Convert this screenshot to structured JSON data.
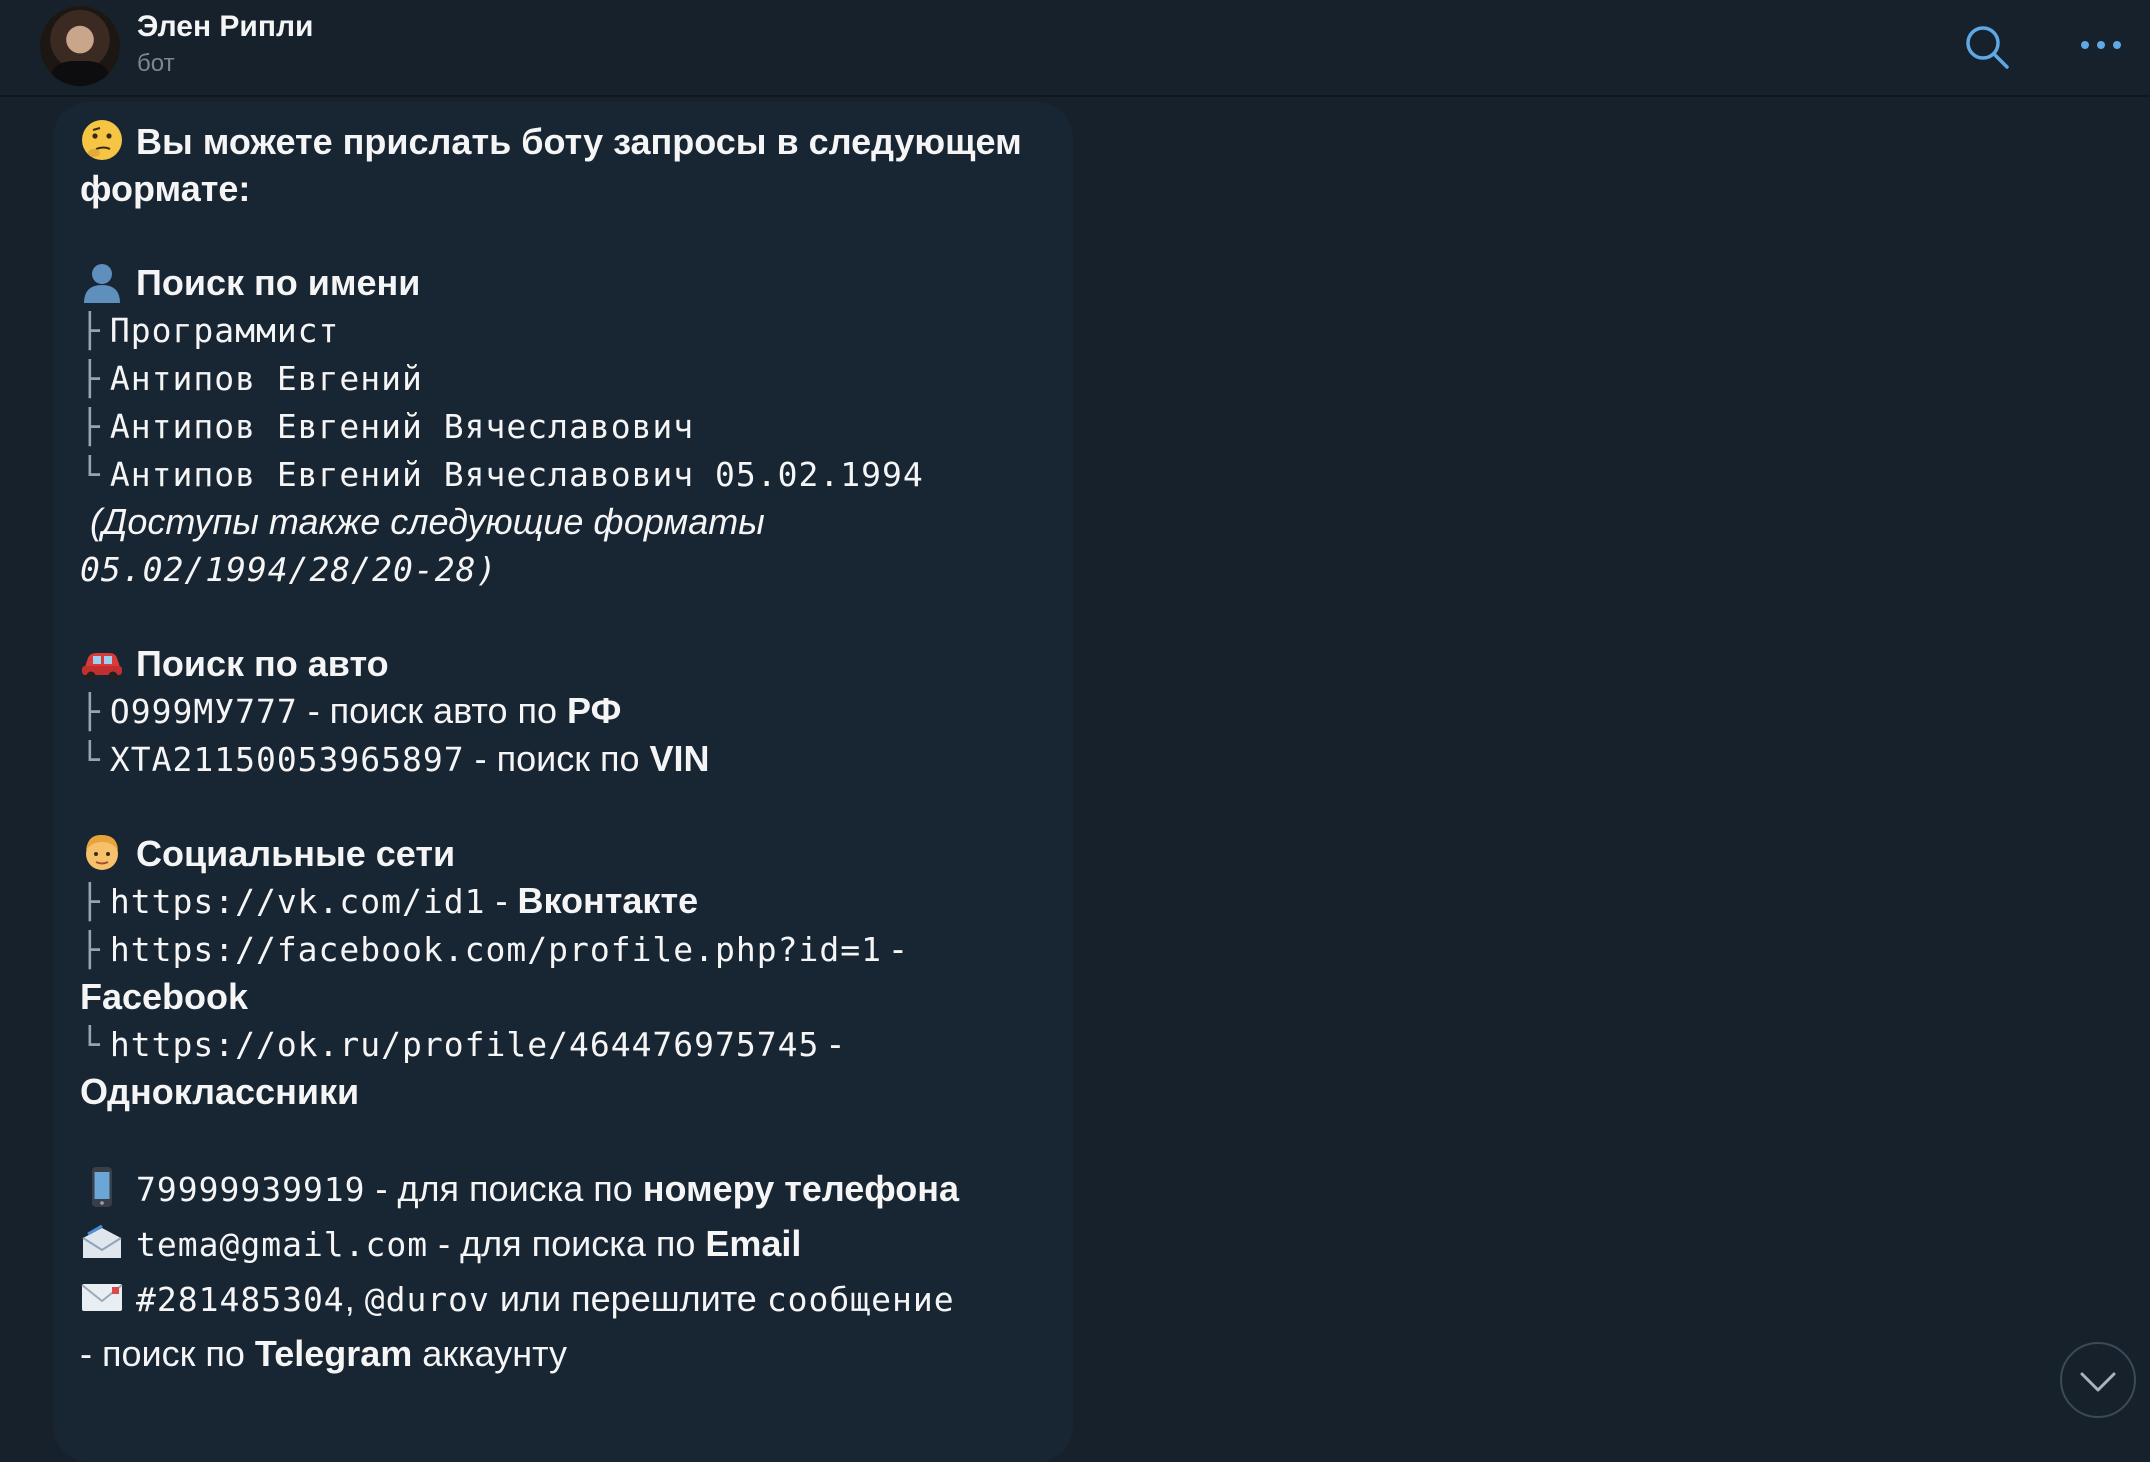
{
  "header": {
    "title": "Элен Рипли",
    "subtitle": "бот"
  },
  "icons": {
    "search": "search-icon",
    "more": "more-icon",
    "scroll_down": "chevron-down-icon"
  },
  "message": {
    "intro": "Вы можете прислать боту запросы в следующем",
    "intro2": "формате:",
    "name_search": {
      "heading": "Поиск по имени",
      "lines": [
        "Программист",
        "Антипов Евгений",
        "Антипов Евгений Вячеславович",
        "Антипов Евгений Вячеславович 05.02.1994"
      ],
      "note1": "(Доступы также следующие форматы",
      "note2": "05.02/1994/28/20-28)"
    },
    "auto_search": {
      "heading": "Поиск по авто",
      "plate": "О999МУ777",
      "plate_text": " - поиск авто по ",
      "plate_bold": "РФ",
      "vin": "XTA21150053965897",
      "vin_text": " - поиск по ",
      "vin_bold": "VIN"
    },
    "social": {
      "heading": "Социальные сети",
      "vk_url": "https://vk.com/id1",
      "vk_label": "Вконтакте",
      "fb_url": "https://facebook.com/profile.php?id=1",
      "fb_label": "Facebook",
      "ok_url": "https://ok.ru/profile/464476975745",
      "ok_label": "Одноклассники"
    },
    "phone": {
      "value": "79999939919",
      "text": " - для поиска по ",
      "bold": "номеру телефона"
    },
    "email": {
      "value": "tema@gmail.com",
      "text": " - для поиска по ",
      "bold": "Email"
    },
    "telegram": {
      "id": "#281485304",
      "sep": ", ",
      "username": "@durov",
      "or": " или перешлите ",
      "forward": "сообщение",
      "line2_text": "- поиск по ",
      "line2_bold": "Telegram",
      "line2_end": " аккаунту"
    }
  },
  "tree": {
    "mid": "├",
    "end": "└"
  },
  "separator": " - ",
  "colors": {
    "background": "#17212b",
    "bubble": "#182533",
    "accent": "#5ea8e6",
    "text": "#f5f5f5",
    "muted": "#7b8693"
  }
}
